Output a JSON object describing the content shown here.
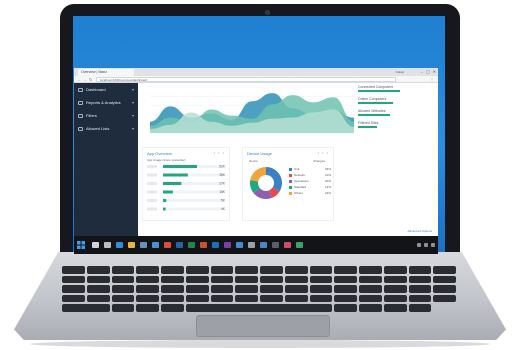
{
  "browser": {
    "tab_title": "Overview | Manz",
    "user_label": "Nakali",
    "url": "localhost:4200/overview/dashboard",
    "controls": [
      "–",
      "▢",
      "✕"
    ]
  },
  "sidebar": {
    "items": [
      {
        "label": "Dashboard",
        "icon": "dashboard-icon",
        "chevron": "▾"
      },
      {
        "label": "Reports & Analytics",
        "icon": "chart-icon",
        "chevron": "▾"
      },
      {
        "label": "Filters",
        "icon": "filter-icon",
        "chevron": "▾"
      },
      {
        "label": "Allowed Lists",
        "icon": "list-icon",
        "chevron": "▾"
      }
    ]
  },
  "stats": [
    {
      "label": "Connected Computers",
      "fill": 0.65
    },
    {
      "label": "Online Computers",
      "fill": 0.55
    },
    {
      "label": "Allowed Websites",
      "fill": 0.5
    },
    {
      "label": "Filtered Sites",
      "fill": 0.3
    }
  ],
  "app_panel": {
    "title": "App Overview",
    "dots": "• • •",
    "subtitle": "App Usage (since yesterday)"
  },
  "dev_panel": {
    "title": "Device Usage",
    "dots": "• • •",
    "col_device": "Device",
    "col_change": "Changes"
  },
  "footer_link": "Advanced Options",
  "colors": {
    "accent": "#1fa97e",
    "sidebar": "#1e2c3d",
    "link": "#3b82c4"
  },
  "chart_data": [
    {
      "type": "area",
      "series": [
        {
          "values": [
            22,
            52,
            30,
            38,
            26,
            62,
            78,
            48,
            36,
            44,
            30
          ]
        },
        {
          "values": [
            14,
            30,
            20,
            46,
            34,
            28,
            56,
            74,
            60,
            70,
            22
          ]
        },
        {
          "values": [
            8,
            16,
            40,
            22,
            14,
            20,
            28,
            30,
            40,
            46,
            12
          ]
        }
      ],
      "colors": [
        "#2f8fb5",
        "#6fc2b0",
        "#b6e0d2"
      ],
      "ylim": [
        0,
        90
      ]
    },
    {
      "type": "bar",
      "categories": [
        "",
        "",
        "",
        "",
        "",
        ""
      ],
      "values": [
        52,
        38,
        28,
        15,
        5,
        4
      ],
      "value_labels": [
        "52K",
        "38K",
        "27K",
        "15K",
        "5K",
        "4K"
      ],
      "color": "#1fa97e"
    },
    {
      "type": "pie",
      "variant": "donut",
      "slices": [
        {
          "value": 34,
          "color": "#3b82c4"
        },
        {
          "value": 10,
          "color": "#e54b4b"
        },
        {
          "value": 20,
          "color": "#8e5fb0"
        },
        {
          "value": 14,
          "color": "#1fa97e"
        },
        {
          "value": 22,
          "color": "#f0a53a"
        }
      ],
      "legend": [
        {
          "label": "Unit",
          "pct": "34%"
        },
        {
          "label": "Network",
          "pct": "10%"
        },
        {
          "label": "Operations",
          "pct": "20%"
        },
        {
          "label": "Standard",
          "pct": "14%"
        },
        {
          "label": "Others",
          "pct": "22%"
        }
      ]
    }
  ],
  "taskbar": {
    "icons": [
      {
        "name": "search-icon",
        "color": "#d0d4da"
      },
      {
        "name": "task-view-icon",
        "color": "#b8bec8"
      },
      {
        "name": "edge-icon",
        "color": "#2d8fd6"
      },
      {
        "name": "explorer-icon",
        "color": "#e7b640"
      },
      {
        "name": "store-icon",
        "color": "#6d8fc0"
      },
      {
        "name": "mail-icon",
        "color": "#4b8fd8"
      },
      {
        "name": "chrome-icon",
        "color": "#e24b3b"
      },
      {
        "name": "word-icon",
        "color": "#2b5fa8"
      },
      {
        "name": "excel-icon",
        "color": "#21884a"
      },
      {
        "name": "powerpoint-icon",
        "color": "#c9532f"
      },
      {
        "name": "outlook-icon",
        "color": "#1e6ec0"
      },
      {
        "name": "onenote-icon",
        "color": "#7b3ba8"
      },
      {
        "name": "photos-icon",
        "color": "#3a8fd0"
      },
      {
        "name": "settings-icon",
        "color": "#9aa0a8"
      },
      {
        "name": "calendar-icon",
        "color": "#4c86c9"
      },
      {
        "name": "terminal-icon",
        "color": "#5a5f68"
      },
      {
        "name": "music-icon",
        "color": "#d04a6a"
      },
      {
        "name": "maps-icon",
        "color": "#37a36b"
      }
    ]
  }
}
